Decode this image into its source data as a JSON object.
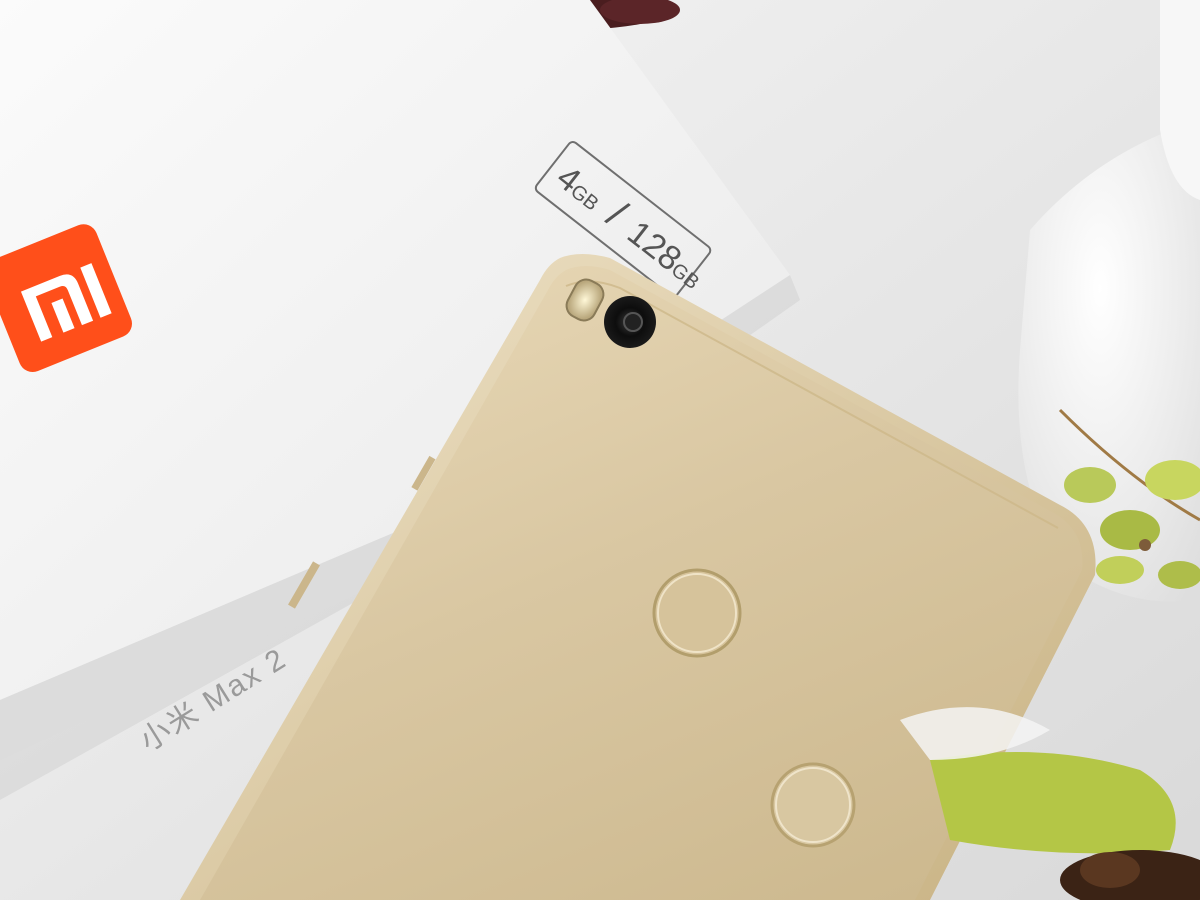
{
  "photo": {
    "box_spec": {
      "ram": "4",
      "ram_unit": "GB",
      "separator": "/",
      "storage": "128",
      "storage_unit": "GB"
    },
    "box_side_text": "小米 Max 2",
    "brand_logo": "mi-logo-icon",
    "colors": {
      "phone_gold": "#d9c7a2",
      "logo_orange": "#ff4f1a",
      "box_white": "#f2f2f2",
      "mug_green": "#b9c95a"
    }
  }
}
